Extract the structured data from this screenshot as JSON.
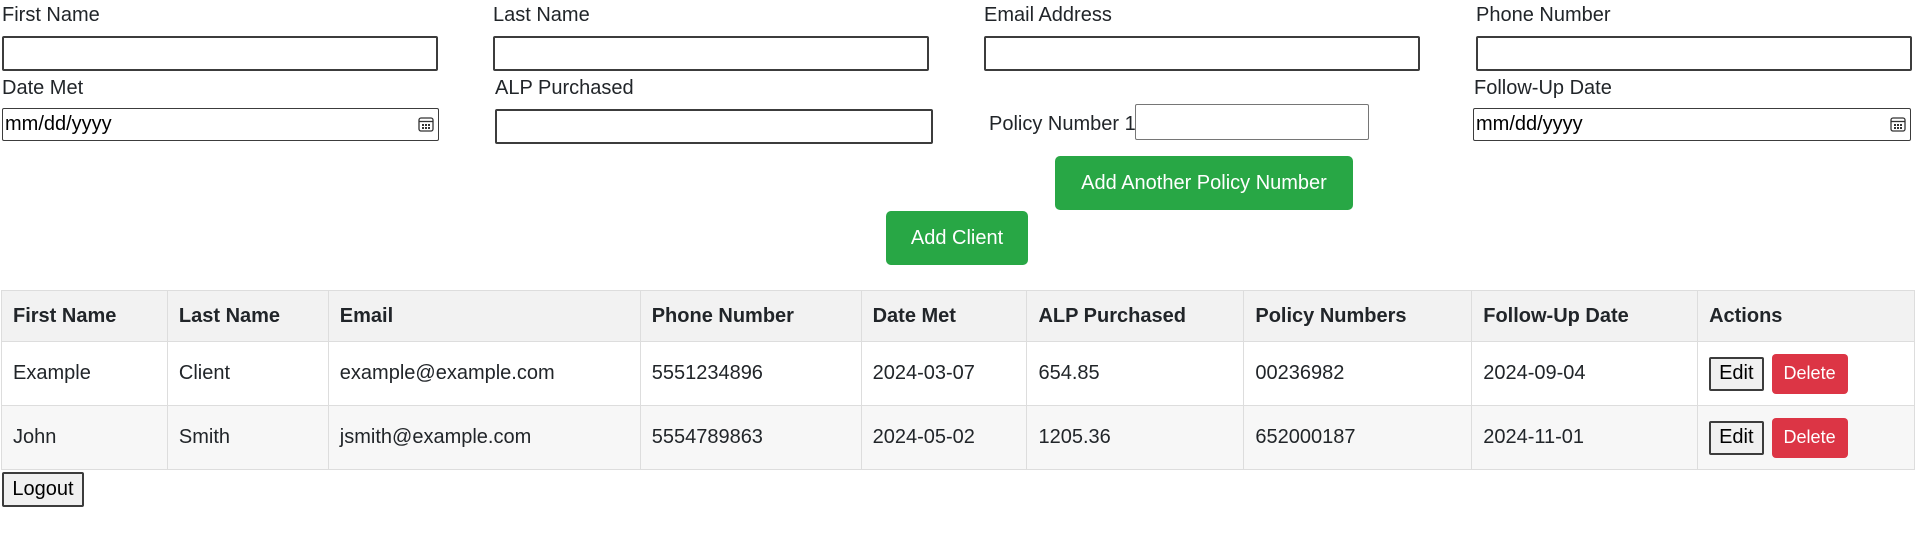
{
  "form": {
    "first_name_label": "First Name",
    "last_name_label": "Last Name",
    "email_label": "Email Address",
    "phone_label": "Phone Number",
    "date_met_label": "Date Met",
    "date_met_value": "mm/dd/yyyy",
    "alp_label": "ALP Purchased",
    "policy_label": "Policy Number 1",
    "followup_label": "Follow-Up Date",
    "followup_value": "mm/dd/yyyy",
    "add_policy_button": "Add Another Policy Number",
    "add_client_button": "Add Client"
  },
  "table": {
    "headers": [
      "First Name",
      "Last Name",
      "Email",
      "Phone Number",
      "Date Met",
      "ALP Purchased",
      "Policy Numbers",
      "Follow-Up Date",
      "Actions"
    ],
    "rows": [
      {
        "first": "Example",
        "last": "Client",
        "email": "example@example.com",
        "phone": "5551234896",
        "date_met": "2024-03-07",
        "alp": "654.85",
        "policies": "00236982",
        "followup": "2024-09-04"
      },
      {
        "first": "John",
        "last": "Smith",
        "email": "jsmith@example.com",
        "phone": "5554789863",
        "date_met": "2024-05-02",
        "alp": "1205.36",
        "policies": "652000187",
        "followup": "2024-11-01"
      }
    ],
    "edit_label": "Edit",
    "delete_label": "Delete"
  },
  "logout_label": "Logout",
  "colors": {
    "primary_green": "#28a745",
    "danger_red": "#dc3545",
    "header_bg": "#f2f2f2"
  },
  "icons": {
    "calendar": "calendar-icon"
  }
}
